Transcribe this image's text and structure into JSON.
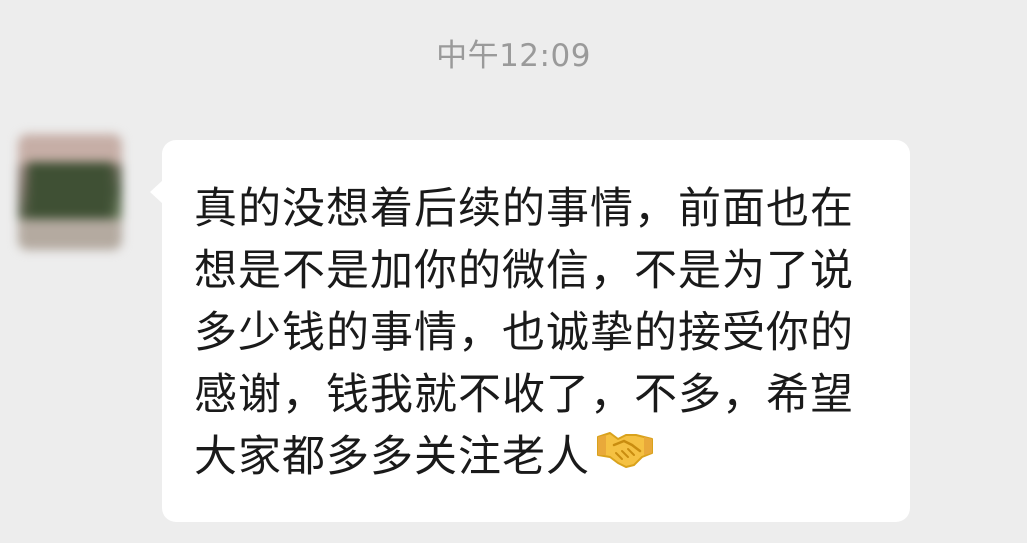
{
  "timestamp": "中午12:09",
  "message": {
    "lines": [
      "真的没想着后续的事情，前面也在",
      "想是不是加你的微信，不是为了说",
      "多少钱的事情，也诚挚的接受你的",
      "感谢，钱我就不收了，不多，希望",
      "大家都多多关注老人"
    ],
    "trailing_emoji": "handshake-icon"
  },
  "colors": {
    "background": "#ededed",
    "bubble": "#ffffff",
    "text": "#1a1a1a",
    "timestamp": "#9a9a9a"
  }
}
